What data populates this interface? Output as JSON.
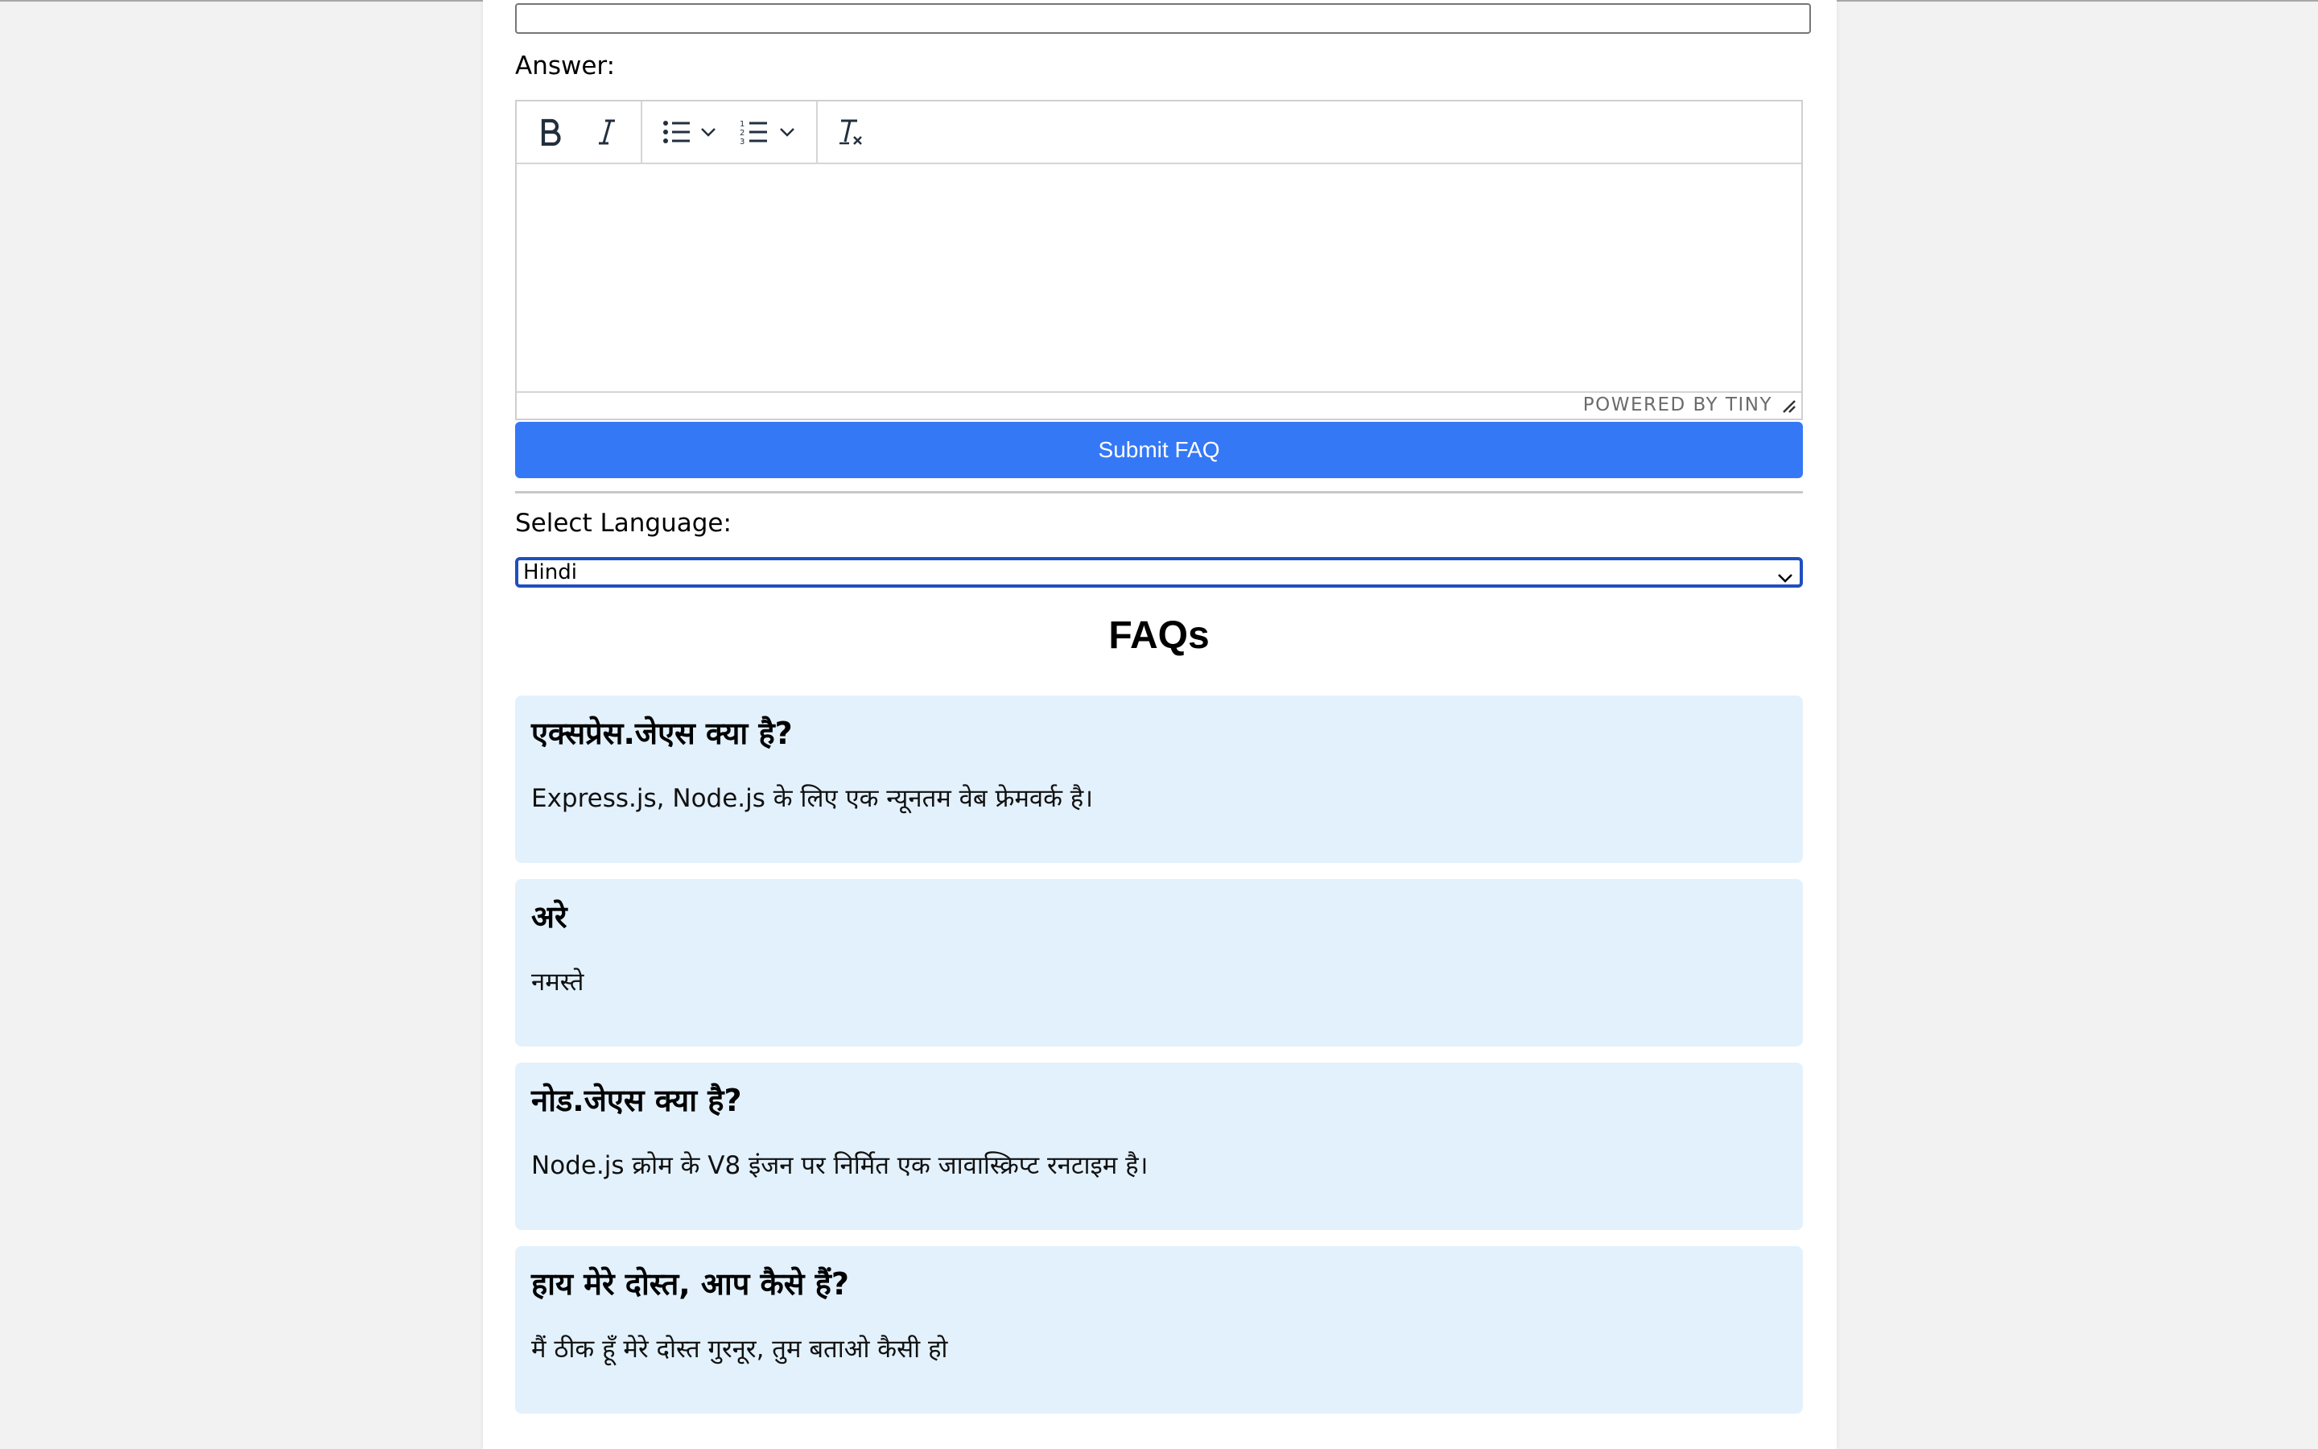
{
  "form": {
    "answer_label": "Answer:",
    "editor": {
      "toolbar_icons": [
        "bold-icon",
        "italic-icon",
        "bullet-list-icon",
        "chevron-down-icon",
        "numbered-list-icon",
        "chevron-down-icon",
        "clear-formatting-icon"
      ],
      "powered_by": "POWERED BY TINY"
    },
    "submit_label": "Submit FAQ"
  },
  "language": {
    "label": "Select Language:",
    "selected": "Hindi"
  },
  "faqs": {
    "title": "FAQs",
    "items": [
      {
        "question": "एक्सप्रेस.जेएस क्या है?",
        "answer": "Express.js, Node.js के लिए एक न्यूनतम वेब फ्रेमवर्क है।"
      },
      {
        "question": "अरे",
        "answer": "नमस्ते"
      },
      {
        "question": "नोड.जेएस क्या है?",
        "answer": "Node.js क्रोम के V8 इंजन पर निर्मित एक जावास्क्रिप्ट रनटाइम है।"
      },
      {
        "question": "हाय मेरे दोस्त, आप कैसे हैं?",
        "answer": "मैं ठीक हूँ मेरे दोस्त गुरनूर, तुम बताओ कैसी हो"
      }
    ]
  },
  "colors": {
    "page_bg": "#f2f2f2",
    "submit_bg": "#3478f6",
    "faq_bg": "#e3f1fc",
    "select_border": "#1f4fbf"
  }
}
